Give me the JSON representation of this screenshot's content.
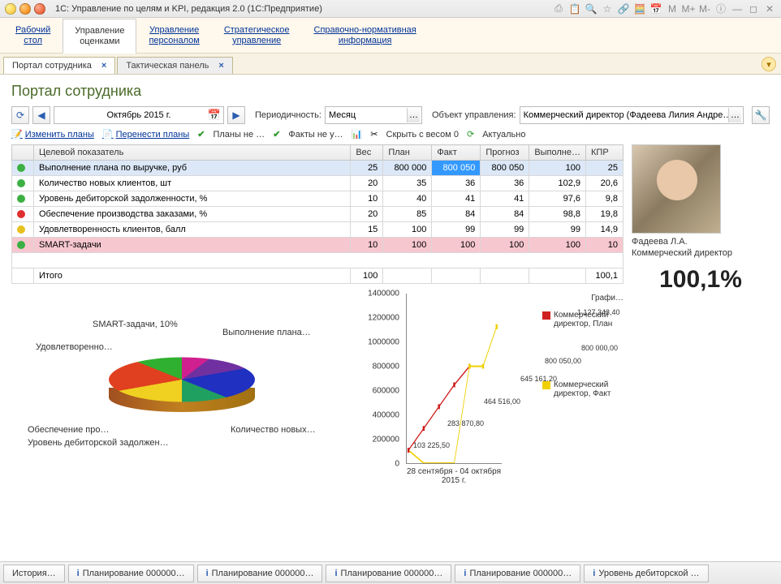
{
  "window": {
    "title": "1С: Управление по целям и KPI, редакция 2.0  (1С:Предприятие)"
  },
  "nav": {
    "items": [
      {
        "l1": "Рабочий",
        "l2": "стол"
      },
      {
        "l1": "Управление",
        "l2": "оценками"
      },
      {
        "l1": "Управление",
        "l2": "персоналом"
      },
      {
        "l1": "Стратегическое",
        "l2": "управление"
      },
      {
        "l1": "Справочно-нормативная",
        "l2": "информация"
      }
    ],
    "active_index": 1
  },
  "tabs": [
    {
      "label": "Портал сотрудника"
    },
    {
      "label": "Тактическая панель"
    }
  ],
  "page": {
    "title": "Портал сотрудника",
    "period": "Октябрь 2015 г.",
    "periodicity_label": "Периодичность:",
    "periodicity_value": "Месяц",
    "object_label": "Объект управления:",
    "object_value": "Коммерческий директор (Фадеева Лилия Андре…"
  },
  "actions": {
    "edit_plans": "Изменить планы",
    "move_plans": "Перенести планы",
    "plans_not": "Планы не …",
    "facts_not": "Факты не у…",
    "hide_zero": "Скрыть с весом 0",
    "actual": "Актуально"
  },
  "columns": {
    "c0": "Целевой показатель",
    "c1": "Вес",
    "c2": "План",
    "c3": "Факт",
    "c4": "Прогноз",
    "c5": "Выполне…",
    "c6": "КПР"
  },
  "rows": [
    {
      "status": "green",
      "name": "Выполнение плана по выручке, руб",
      "w": "25",
      "plan": "800 000",
      "fact": "800 050",
      "prog": "800 050",
      "exec": "100",
      "kpr": "25",
      "sel": true,
      "hl_fact": true
    },
    {
      "status": "green",
      "name": "Количество новых клиентов, шт",
      "w": "20",
      "plan": "35",
      "fact": "36",
      "prog": "36",
      "exec": "102,9",
      "kpr": "20,6"
    },
    {
      "status": "green",
      "name": "Уровень дебиторской задолженности, %",
      "w": "10",
      "plan": "40",
      "fact": "41",
      "prog": "41",
      "exec": "97,6",
      "kpr": "9,8"
    },
    {
      "status": "red",
      "name": "Обеспечение производства заказами, %",
      "w": "20",
      "plan": "85",
      "fact": "84",
      "prog": "84",
      "exec": "98,8",
      "kpr": "19,8"
    },
    {
      "status": "yellow",
      "name": "Удовлетворенность клиентов, балл",
      "w": "15",
      "plan": "100",
      "fact": "99",
      "prog": "99",
      "exec": "99",
      "kpr": "14,9"
    },
    {
      "status": "green",
      "name": "SMART-задачи",
      "w": "10",
      "plan": "100",
      "fact": "100",
      "prog": "100",
      "exec": "100",
      "kpr": "10",
      "pink": true
    }
  ],
  "totals": {
    "label": "Итого",
    "w": "100",
    "kpr": "100,1"
  },
  "person": {
    "name": "Фадеева Л.А.",
    "role": "Коммерческий директор",
    "score": "100,1%"
  },
  "pie_labels": {
    "smart": "SMART-задачи, 10%",
    "udovl": "Удовлетворенно…",
    "obesp": "Обеспечение про…",
    "debit": "Уровень дебиторской задолжен…",
    "vypol": "Выполнение  плана…",
    "kolvo": "Количество  новых…"
  },
  "line_chart": {
    "title": "Графи…",
    "x_label": "28 сентября - 04 октября 2015 г.",
    "legend_plan": "Коммерческий директор, План",
    "legend_fact": "Коммерческий директор, Факт",
    "points": {
      "p1": "103 225,50",
      "p2": "283 870,80",
      "p3": "464 516,00",
      "p4": "645 161,20",
      "p5": "800 050,00",
      "p6": "800 000,00",
      "p7": "1 127 343,40"
    }
  },
  "statusbar": {
    "history": "История…",
    "items": [
      "Планирование 000000…",
      "Планирование 000000…",
      "Планирование 000000…",
      "Планирование 000000…",
      "Уровень дебиторской …"
    ]
  },
  "chart_data": [
    {
      "type": "pie",
      "title": "",
      "series": [
        {
          "name": "Выполнение плана по выручке",
          "value": 25
        },
        {
          "name": "Количество новых клиентов",
          "value": 20
        },
        {
          "name": "Уровень дебиторской задолженности",
          "value": 10
        },
        {
          "name": "Обеспечение производства заказами",
          "value": 20
        },
        {
          "name": "Удовлетворенность клиентов",
          "value": 15
        },
        {
          "name": "SMART-задачи",
          "value": 10
        }
      ]
    },
    {
      "type": "line",
      "title": "График",
      "xlabel": "28 сентября - 04 октября 2015 г.",
      "ylabel": "",
      "ylim": [
        0,
        1400000
      ],
      "x": [
        1,
        2,
        3,
        4,
        5,
        6,
        7
      ],
      "series": [
        {
          "name": "Коммерческий директор, План",
          "color": "#d02020",
          "values": [
            103225.5,
            283870.8,
            464516.0,
            645161.2,
            800000.0,
            null,
            null
          ]
        },
        {
          "name": "Коммерческий директор, Факт",
          "color": "#f0d000",
          "values": [
            103225.5,
            0,
            0,
            0,
            800050.0,
            800000.0,
            1127343.4
          ]
        }
      ]
    }
  ]
}
